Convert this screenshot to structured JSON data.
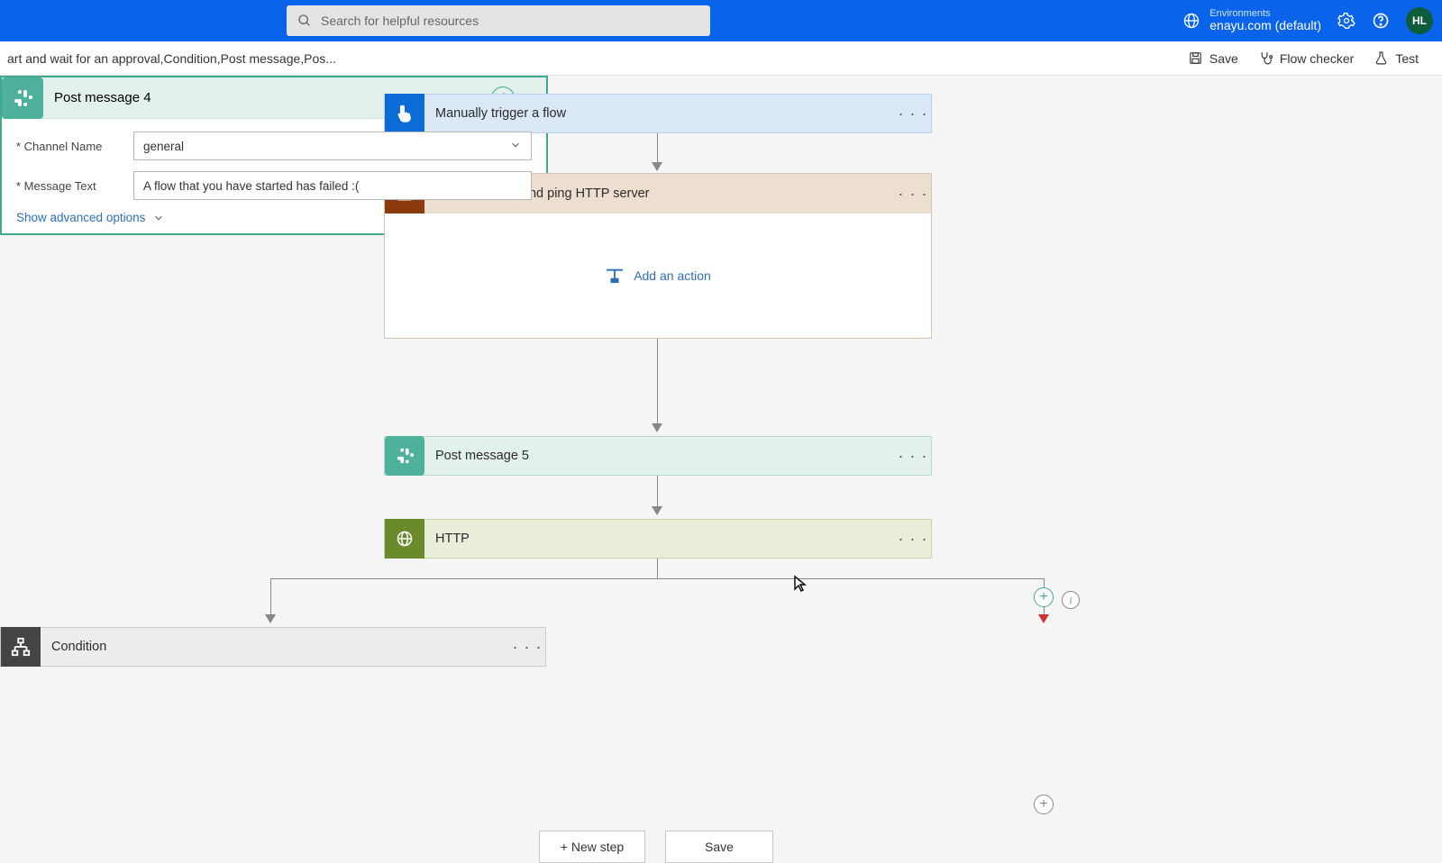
{
  "topbar": {
    "search_placeholder": "Search for helpful resources",
    "env_label": "Environments",
    "env_value": "enayu.com (default)",
    "avatar_initials": "HL"
  },
  "secondbar": {
    "breadcrumb": "art and wait for an approval,Condition,Post message,Pos...",
    "save_label": "Save",
    "checker_label": "Flow checker",
    "test_label": "Test"
  },
  "flow": {
    "trigger_title": "Manually trigger a flow",
    "scope_title": "Post message and ping HTTP server",
    "add_action_label": "Add an action",
    "pm5_title": "Post message 5",
    "http_title": "HTTP",
    "condition_title": "Condition",
    "pm4": {
      "title": "Post message 4",
      "channel_label": "Channel Name",
      "channel_value": "general",
      "message_label": "Message Text",
      "message_value": "A flow that you have started has failed :(",
      "advanced_label": "Show advanced options"
    },
    "new_step_label": "+ New step",
    "save_btn_label": "Save"
  }
}
